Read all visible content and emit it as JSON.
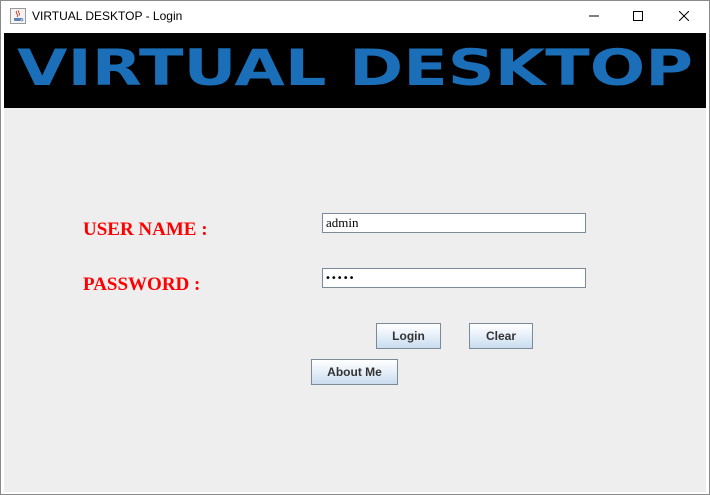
{
  "window": {
    "title": "VIRTUAL DESKTOP - Login",
    "controls": {
      "minimize_icon": "minimize-icon",
      "maximize_icon": "maximize-icon",
      "close_icon": "close-icon"
    }
  },
  "banner": {
    "text": "VIRTUAL DESKTOP",
    "text_color": "#1a6fb8",
    "background_color": "#000000"
  },
  "form": {
    "username_label": "USER NAME :",
    "username_value": "admin",
    "password_label": "PASSWORD :",
    "password_value": "•••••",
    "label_color": "#ff0000"
  },
  "buttons": {
    "login": "Login",
    "clear": "Clear",
    "about": "About Me"
  }
}
